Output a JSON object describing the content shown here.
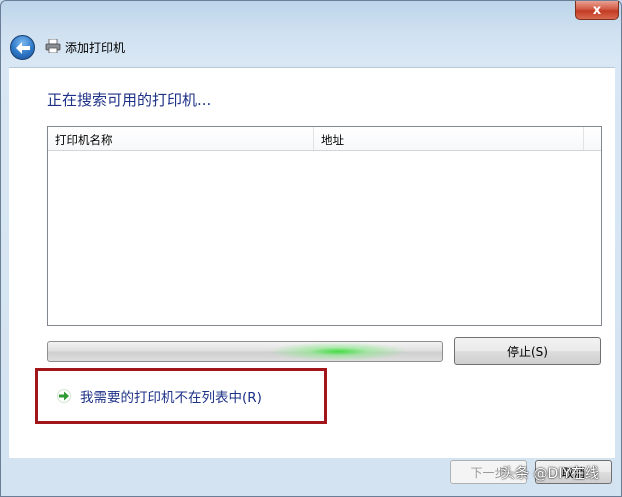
{
  "window": {
    "title": "添加打印机",
    "close_label": "x"
  },
  "main": {
    "heading": "正在搜索可用的打印机...",
    "list": {
      "columns": [
        "打印机名称",
        "地址"
      ],
      "rows": []
    },
    "stop_button": "停止(S)",
    "not_listed_link": "我需要的打印机不在列表中(R)"
  },
  "footer": {
    "next_button": "下一步",
    "cancel_button": "取消"
  },
  "watermark": "头条 @DIY在线",
  "colors": {
    "heading": "#1e3287",
    "highlight_border": "#a1161b",
    "progress_glow": "#3cdc3c"
  }
}
